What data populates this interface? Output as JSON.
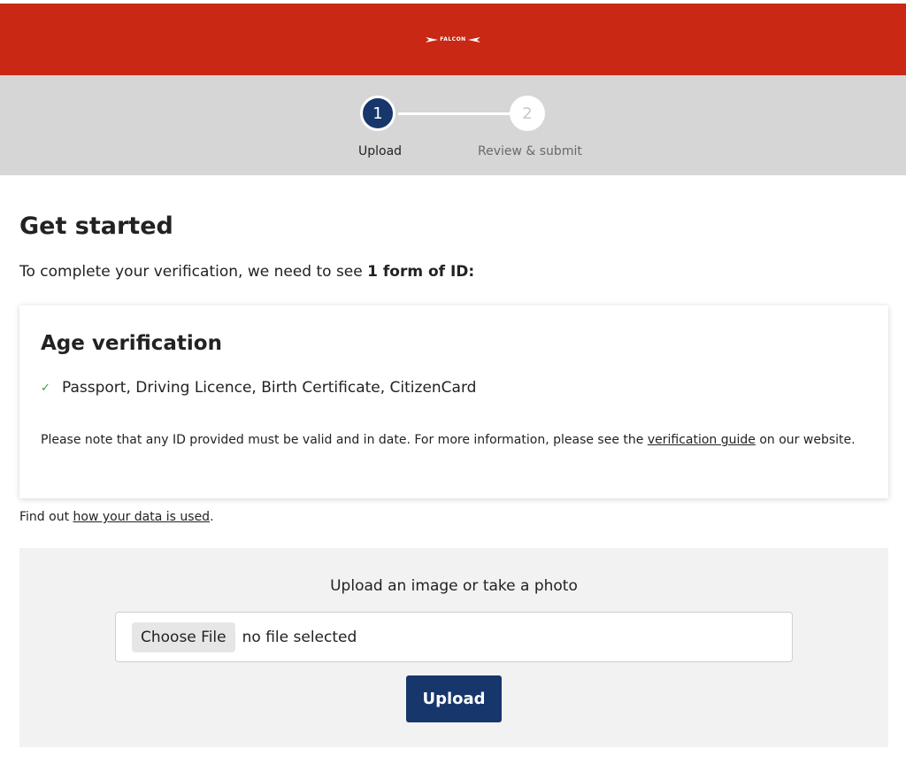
{
  "header": {
    "brand_color": "#c82814",
    "logo_text": "FALCON"
  },
  "stepper": {
    "steps": [
      {
        "number": "1",
        "label": "Upload",
        "active": true
      },
      {
        "number": "2",
        "label": "Review & submit",
        "active": false
      }
    ],
    "active_color": "#17366b"
  },
  "main": {
    "title": "Get started",
    "intro_prefix": "To complete your verification, we need to see ",
    "intro_bold": "1 form of ID:"
  },
  "card": {
    "title": "Age verification",
    "documents": "Passport, Driving Licence, Birth Certificate, CitizenCard",
    "note_prefix": "Please note that any ID provided must be valid and in date. For more information, please see the ",
    "note_link": "verification guide",
    "note_suffix": " on our website."
  },
  "data_usage": {
    "prefix": "Find out ",
    "link": "how your data is used",
    "suffix": "."
  },
  "upload": {
    "title": "Upload an image or take a photo",
    "choose_file_label": "Choose File",
    "file_status": "no file selected",
    "upload_button": "Upload"
  },
  "icons": {
    "check": "checkmark-icon",
    "logo": "falcon-logo"
  }
}
